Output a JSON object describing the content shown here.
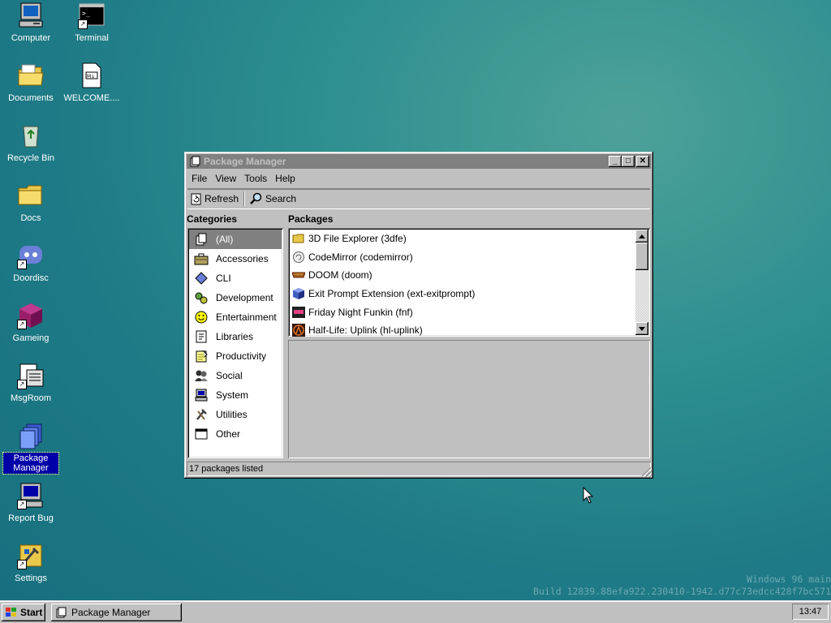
{
  "desktop": {
    "icons": [
      {
        "label": "Computer"
      },
      {
        "label": "Terminal"
      },
      {
        "label": "Documents"
      },
      {
        "label": "WELCOME...."
      },
      {
        "label": "Recycle Bin"
      },
      {
        "label": "Docs"
      },
      {
        "label": "Doordisc"
      },
      {
        "label": "Gameing"
      },
      {
        "label": "MsgRoom"
      },
      {
        "label": "Package Manager"
      },
      {
        "label": "Report Bug"
      },
      {
        "label": "Settings"
      }
    ],
    "terminal_glyph": ">_",
    "md_glyph": "M↓",
    "watermark_line1": "Windows 96 main",
    "watermark_line2": "Build 12839.88efa922.230410-1942.d77c73edcc428f7bc571"
  },
  "window": {
    "title": "Package Manager",
    "buttons": {
      "minimize": "_",
      "maximize": "□",
      "close": "✕"
    },
    "menu": [
      "File",
      "View",
      "Tools",
      "Help"
    ],
    "toolbar": {
      "refresh": "Refresh",
      "search": "Search"
    },
    "categories_header": "Categories",
    "packages_header": "Packages",
    "categories": [
      {
        "label": "(All)",
        "icon": "all-icon",
        "selected": true
      },
      {
        "label": "Accessories",
        "icon": "briefcase-icon"
      },
      {
        "label": "CLI",
        "icon": "diamond-icon"
      },
      {
        "label": "Development",
        "icon": "gears-icon"
      },
      {
        "label": "Entertainment",
        "icon": "smiley-icon"
      },
      {
        "label": "Libraries",
        "icon": "book-icon"
      },
      {
        "label": "Productivity",
        "icon": "notepad-icon"
      },
      {
        "label": "Social",
        "icon": "people-icon"
      },
      {
        "label": "System",
        "icon": "computer-icon"
      },
      {
        "label": "Utilities",
        "icon": "tools-icon"
      },
      {
        "label": "Other",
        "icon": "window-icon"
      }
    ],
    "packages": [
      {
        "label": "3D File Explorer (3dfe)",
        "icon": "folder-icon"
      },
      {
        "label": "CodeMirror (codemirror)",
        "icon": "codemirror-icon"
      },
      {
        "label": "DOOM (doom)",
        "icon": "doom-icon"
      },
      {
        "label": "Exit Prompt Extension (ext-exitprompt)",
        "icon": "cube-icon"
      },
      {
        "label": "Friday Night Funkin (fnf)",
        "icon": "fnf-icon"
      },
      {
        "label": "Half-Life: Uplink (hl-uplink)",
        "icon": "halflife-icon"
      }
    ],
    "status": "17 packages listed"
  },
  "taskbar": {
    "start": "Start",
    "task": "Package Manager",
    "clock": "13:47"
  }
}
